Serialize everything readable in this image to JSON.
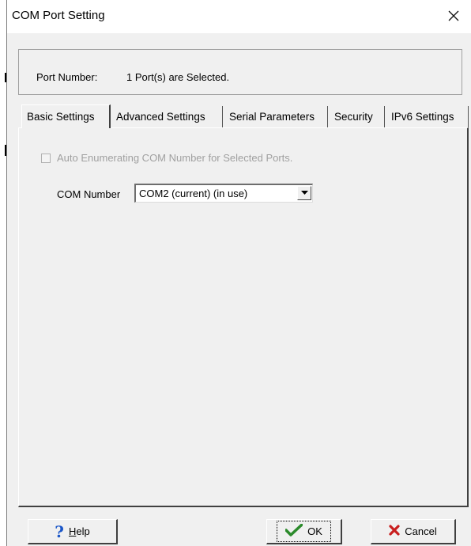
{
  "dialog": {
    "title": "COM Port Setting",
    "port_number_label": "Port Number:",
    "port_number_value": "1 Port(s) are Selected."
  },
  "tabs": [
    {
      "label": "Basic Settings",
      "active": true
    },
    {
      "label": "Advanced Settings",
      "active": false
    },
    {
      "label": "Serial Parameters",
      "active": false
    },
    {
      "label": "Security",
      "active": false
    },
    {
      "label": "IPv6 Settings",
      "active": false
    }
  ],
  "basic": {
    "auto_enum_label": "Auto Enumerating COM Number for Selected Ports.",
    "auto_enum_checked": false,
    "auto_enum_enabled": false,
    "com_number_label": "COM Number",
    "com_number_value": "COM2 (current) (in use)"
  },
  "buttons": {
    "help_mnemonic": "H",
    "help_rest": "elp",
    "ok_label": "OK",
    "cancel_label": "Cancel"
  },
  "colors": {
    "help_icon": "#1a56c8",
    "ok_icon": "#2b8a2b",
    "cancel_icon": "#c81e1e"
  }
}
